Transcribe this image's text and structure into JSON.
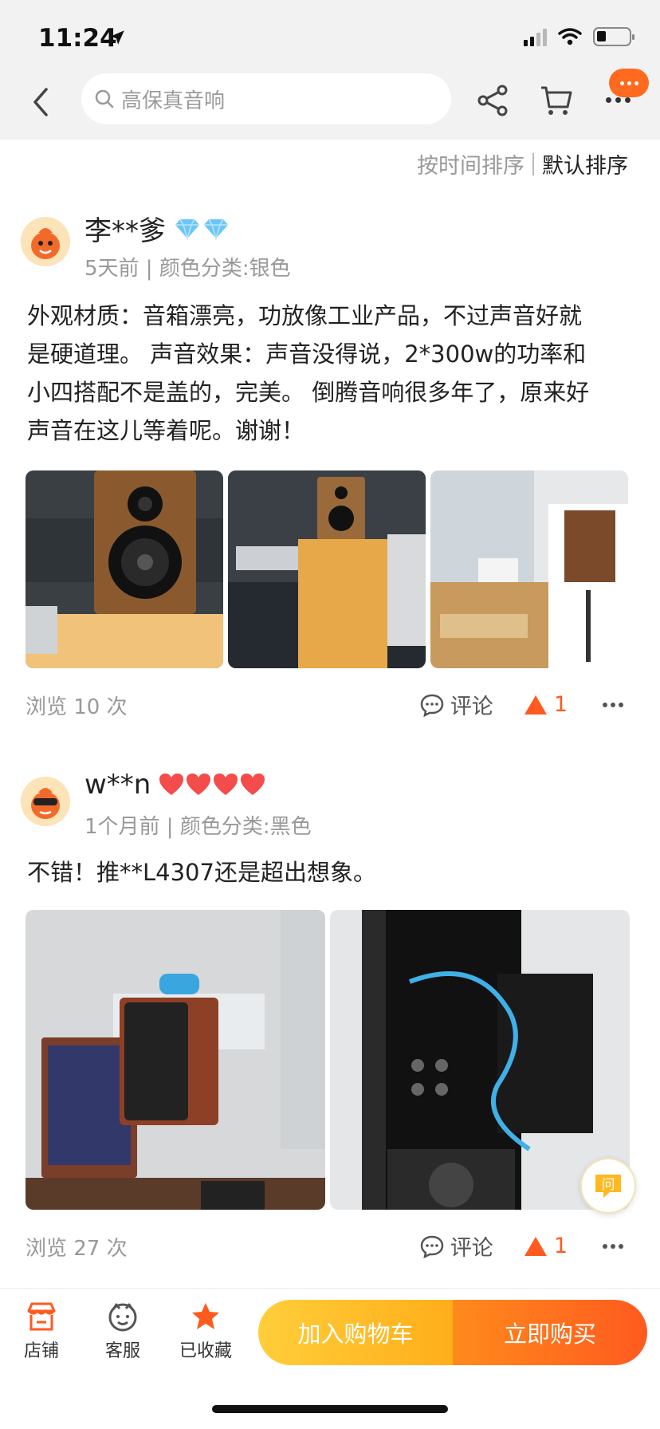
{
  "status": {
    "time": "11:24"
  },
  "header": {
    "search_placeholder": "高保真音响"
  },
  "sort": {
    "by_time": "按时间排序",
    "default": "默认排序"
  },
  "reviews": [
    {
      "username": "李**爹",
      "badge_icon": "diamond-icon",
      "meta": "5天前 | 颜色分类:银色",
      "text_lines": [
        "外观材质：音箱漂亮，功放像工业产品，不过声音好就",
        "是硬道理。 声音效果：声音没得说，2*300w的功率和",
        "小四搭配不是盖的，完美。 倒腾音响很多年了，原来好",
        "声音在这儿等着呢。谢谢！"
      ],
      "views": "浏览 10 次",
      "comment_label": "评论",
      "likes": "1"
    },
    {
      "username": "w**n",
      "badge_icon": "heart-icon",
      "meta": "1个月前 | 颜色分类:黑色",
      "text_lines": [
        "不错！推**L4307还是超出想象。"
      ],
      "views": "浏览 27 次",
      "comment_label": "评论",
      "likes": "1"
    }
  ],
  "bottom_bar": {
    "store": "店铺",
    "service": "客服",
    "favorited": "已收藏",
    "add_to_cart": "加入购物车",
    "buy_now": "立即购买"
  },
  "float": {
    "ask": "问"
  },
  "colors": {
    "accent": "#ff5a1f",
    "cart": "#ffbe2a",
    "badge": "#ff6a1f"
  }
}
